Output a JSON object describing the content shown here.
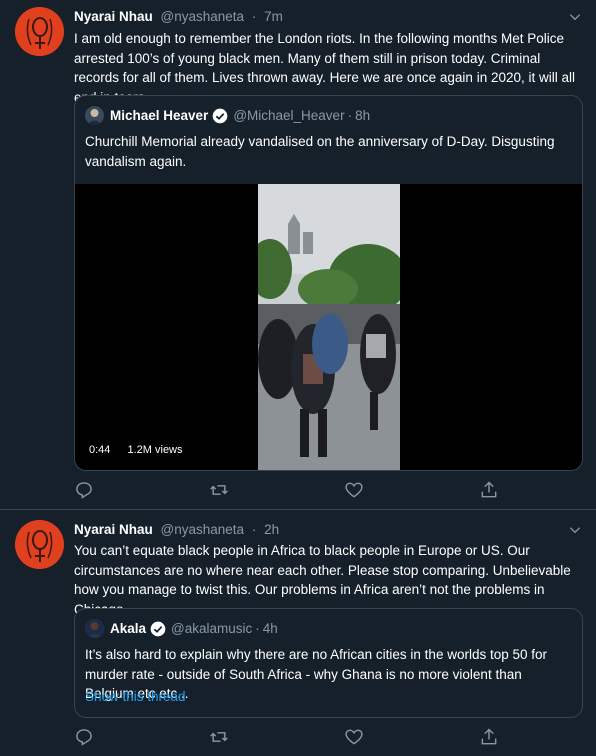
{
  "colors": {
    "background": "#15202b",
    "border": "#38444d",
    "muted": "#8899a6",
    "accent": "#1da1f2",
    "avatar": "#e0401e"
  },
  "tweets": [
    {
      "author_name": "Nyarai Nhau",
      "author_handle": "@nyashaneta",
      "time": "7m",
      "text": "I am old enough to remember the London riots. In the following months Met Police arrested 100’s of young black men. Many of them still in prison today. Criminal records for all of them. Lives thrown away. Here we are once again in 2020, it will all end in tears",
      "quote": {
        "author_name": "Michael Heaver",
        "author_handle": "@Michael_Heaver",
        "time": "8h",
        "text": "Churchill Memorial already vandalised on the anniversary of D-Day. Disgusting vandalism again.",
        "video_duration": "0:44",
        "video_views": "1.2M views"
      }
    },
    {
      "author_name": "Nyarai Nhau",
      "author_handle": "@nyashaneta",
      "time": "2h",
      "text": "You can’t equate black people in Africa to black people in Europe or US. Our circumstances are no where near each other. Please stop comparing. Unbelievable how you manage to twist this. Our problems in Africa aren’t not the problems in Chicago",
      "quote": {
        "author_name": "Akala",
        "author_handle": "@akalamusic",
        "time": "4h",
        "text": "It’s also hard to explain why there are no African cities in the worlds top 50 for murder rate - outside of South Africa - why Ghana is no more violent than Belgium etc etc...",
        "thread_link": "Show this thread"
      }
    }
  ],
  "separator": "·",
  "icons": [
    "reply-icon",
    "retweet-icon",
    "like-icon",
    "share-icon",
    "chevron-down-icon",
    "verified-icon"
  ]
}
